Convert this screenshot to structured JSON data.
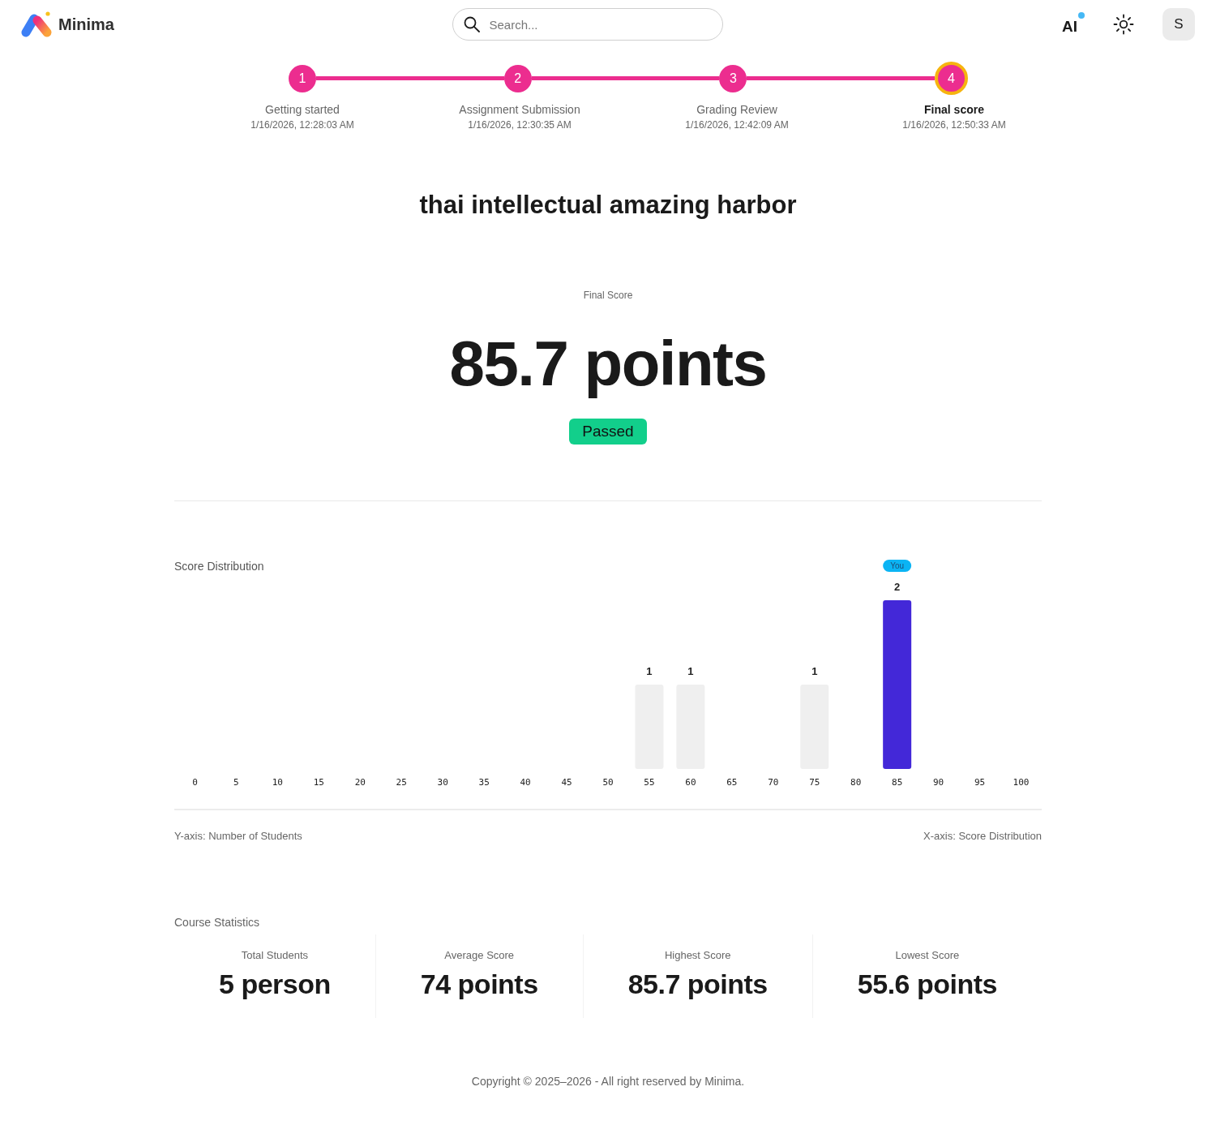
{
  "header": {
    "logo": "Minima",
    "search": {
      "placeholder": "Search..."
    },
    "ai_button": {
      "label": "AI",
      "notification": true
    },
    "avatar": {
      "initial": "S"
    }
  },
  "steps": [
    {
      "number": "1",
      "label": "Getting started",
      "date": "1/16/2026, 12:28:03 AM",
      "selected": false
    },
    {
      "number": "2",
      "label": "Assignment Submission",
      "date": "1/16/2026, 12:30:35 AM",
      "selected": false
    },
    {
      "number": "3",
      "label": "Grading Review",
      "date": "1/16/2026, 12:42:09 AM",
      "selected": false
    },
    {
      "number": "4",
      "label": "Final score",
      "date": "1/16/2026, 12:50:33 AM",
      "selected": true
    }
  ],
  "title": "thai intellectual amazing harbor",
  "result": {
    "label": "Final Score",
    "score": "85.7 points",
    "status": "Passed",
    "passed": true
  },
  "score_distribution": {
    "chart_data": {
      "type": "bar",
      "title": "Score Distribution",
      "xlabel": "X-axis: Score Distribution",
      "ylabel": "Y-axis: Number of Students",
      "categories": [
        "0",
        "5",
        "10",
        "15",
        "20",
        "25",
        "30",
        "35",
        "40",
        "45",
        "50",
        "55",
        "60",
        "65",
        "70",
        "75",
        "80",
        "85",
        "90",
        "95",
        "100"
      ],
      "stacked": true,
      "series": [
        {
          "color": "#efefef",
          "values": [
            0,
            0,
            0,
            0,
            0,
            0,
            0,
            0,
            0,
            0,
            0,
            1,
            1,
            0,
            0,
            1,
            0,
            0,
            0,
            0,
            0
          ],
          "value_labels": [
            null,
            null,
            null,
            null,
            null,
            null,
            null,
            null,
            null,
            null,
            null,
            "1",
            "1",
            null,
            null,
            "1",
            null,
            null,
            null,
            null,
            null
          ]
        },
        {
          "name": "You",
          "color": "#4328d8",
          "values": [
            0,
            0,
            0,
            0,
            0,
            0,
            0,
            0,
            0,
            0,
            0,
            0,
            0,
            0,
            0,
            0,
            0,
            2,
            0,
            0,
            0
          ],
          "value_labels": [
            null,
            null,
            null,
            null,
            null,
            null,
            null,
            null,
            null,
            null,
            null,
            null,
            null,
            null,
            null,
            null,
            null,
            "2",
            null,
            null,
            null
          ]
        }
      ]
    }
  },
  "course_statistics": {
    "title": "Course Statistics",
    "stats": [
      {
        "label": "Total Students",
        "value": "5 person"
      },
      {
        "label": "Average Score",
        "value": "74 points"
      },
      {
        "label": "Highest Score",
        "value": "85.7 points"
      },
      {
        "label": "Lowest Score",
        "value": "55.6 points"
      }
    ]
  },
  "footer": "Copyright © 2025–2026 - All right reserved by Minima."
}
